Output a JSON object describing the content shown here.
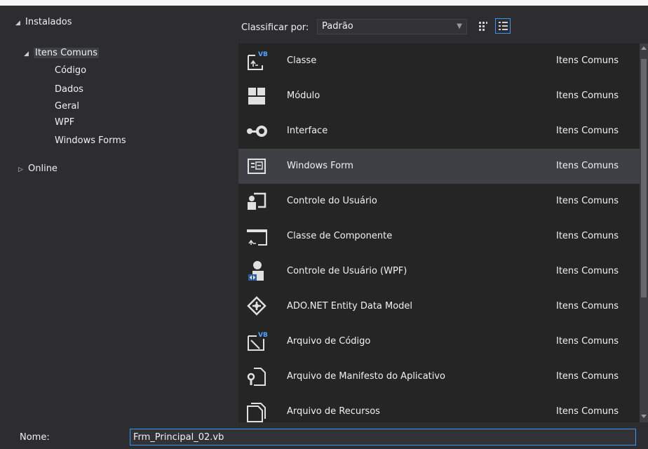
{
  "tree": {
    "installed": "Instalados",
    "common": "Itens Comuns",
    "children": [
      "Código",
      "Dados",
      "Geral",
      "WPF",
      "Windows Forms"
    ],
    "online": "Online"
  },
  "toolbar": {
    "sort_label": "Classificar por:",
    "sort_value": "Padrão"
  },
  "items": [
    {
      "name": "Classe",
      "category": "Itens Comuns",
      "icon": "class-vb-icon"
    },
    {
      "name": "Módulo",
      "category": "Itens Comuns",
      "icon": "module-icon"
    },
    {
      "name": "Interface",
      "category": "Itens Comuns",
      "icon": "interface-icon"
    },
    {
      "name": "Windows Form",
      "category": "Itens Comuns",
      "icon": "windows-form-icon"
    },
    {
      "name": "Controle do Usuário",
      "category": "Itens Comuns",
      "icon": "user-control-icon"
    },
    {
      "name": "Classe de Componente",
      "category": "Itens Comuns",
      "icon": "component-class-icon"
    },
    {
      "name": "Controle de Usuário (WPF)",
      "category": "Itens Comuns",
      "icon": "wpf-user-control-icon"
    },
    {
      "name": "ADO.NET Entity Data Model",
      "category": "Itens Comuns",
      "icon": "entity-model-icon"
    },
    {
      "name": "Arquivo de Código",
      "category": "Itens Comuns",
      "icon": "code-file-vb-icon"
    },
    {
      "name": "Arquivo de Manifesto do Aplicativo",
      "category": "Itens Comuns",
      "icon": "manifest-icon"
    },
    {
      "name": "Arquivo de Recursos",
      "category": "Itens Comuns",
      "icon": "resource-file-icon"
    }
  ],
  "selected_item": "Windows Form",
  "name_field": {
    "label": "Nome:",
    "value": "Frm_Principal_02.vb"
  },
  "colors": {
    "background": "#2d2d30",
    "list_background": "#252526",
    "selection": "#3f3f46",
    "accent": "#3399ff",
    "text": "#f1f1f1"
  }
}
